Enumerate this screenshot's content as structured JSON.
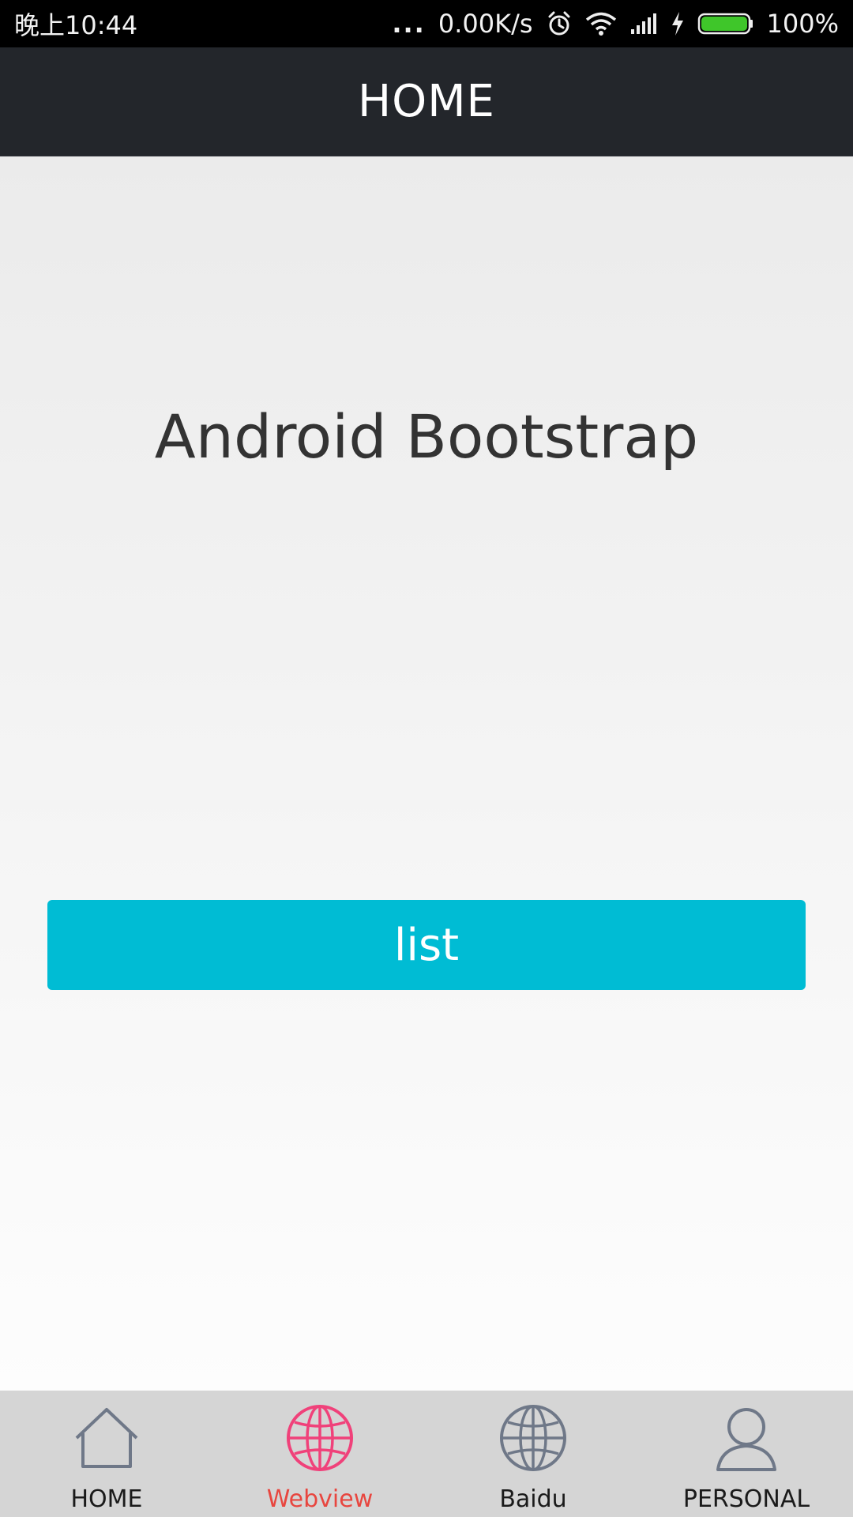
{
  "status_bar": {
    "time": "晚上10:44",
    "dots": "...",
    "net_speed": "0.00K/s",
    "battery_percent": "100%",
    "battery_level": 100,
    "icons": [
      "alarm-icon",
      "wifi-icon",
      "signal-icon",
      "charging-icon",
      "battery-icon"
    ],
    "battery_color": "#3fc62a"
  },
  "app_bar": {
    "title": "HOME"
  },
  "main": {
    "hero_title": "Android Bootstrap",
    "list_button_label": "list",
    "button_color": "#00bcd4"
  },
  "bottom_nav": {
    "items": [
      {
        "label": "HOME",
        "icon": "home-icon",
        "active": false
      },
      {
        "label": "Webview",
        "icon": "globe-icon",
        "active": true
      },
      {
        "label": "Baidu",
        "icon": "globe-icon",
        "active": false
      },
      {
        "label": "PERSONAL",
        "icon": "user-icon",
        "active": false
      }
    ],
    "active_color": "#e8463f",
    "active_icon_color": "#f0417a",
    "inactive_icon_color": "#6f7888"
  }
}
